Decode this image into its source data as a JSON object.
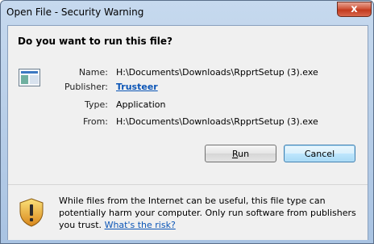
{
  "window": {
    "title": "Open File - Security Warning",
    "close_glyph": "x"
  },
  "dialog": {
    "question": "Do you want to run this file?",
    "icon": "application-file-icon",
    "fields": {
      "name_label": "Name:",
      "name_value": "H:\\Documents\\Downloads\\RpprtSetup (3).exe",
      "publisher_label": "Publisher:",
      "publisher_value": "Trusteer",
      "type_label": "Type:",
      "type_value": "Application",
      "from_label": "From:",
      "from_value": "H:\\Documents\\Downloads\\RpprtSetup (3).exe"
    },
    "buttons": {
      "run": "Run",
      "cancel": "Cancel"
    },
    "warning": {
      "icon": "security-shield-warning-icon",
      "text": "While files from the Internet can be useful, this file type can potentially harm your computer. Only run software from publishers you trust.",
      "link": "What's the risk?"
    }
  },
  "colors": {
    "link": "#0b55b6",
    "titlebar": "#c6d9ee",
    "close_button": "#c23a1e",
    "shield_gold": "#e8a82c"
  }
}
